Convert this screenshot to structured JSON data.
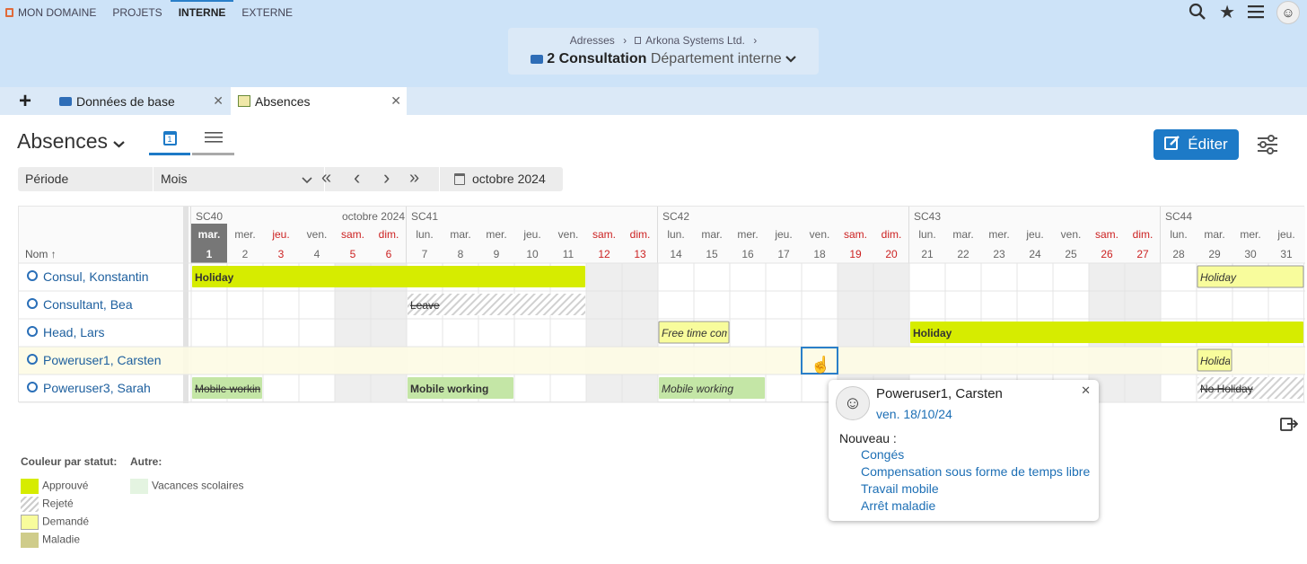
{
  "nav": {
    "items": [
      "MON DOMAINE",
      "PROJETS",
      "INTERNE",
      "EXTERNE"
    ],
    "active_index": 2
  },
  "breadcrumb": {
    "part1": "Adresses",
    "sep": "›",
    "part2": "Arkona Systems Ltd.",
    "sep2": "›"
  },
  "context": {
    "title": "2 Consultation",
    "subtitle": "Département interne"
  },
  "tabs": [
    {
      "label": "Données de base"
    },
    {
      "label": "Absences"
    }
  ],
  "page": {
    "title": "Absences",
    "edit_label": "Éditer"
  },
  "toolbar": {
    "period_label": "Période",
    "period_value": "Mois",
    "first": "«",
    "prev": "‹",
    "next": "›",
    "last": "»",
    "month": "octobre 2024"
  },
  "calendar": {
    "name_header": "Nom",
    "month_label": "octobre 2024",
    "weeks": [
      {
        "label": "SC40",
        "start": 1
      },
      {
        "label": "SC41",
        "start": 7
      },
      {
        "label": "SC42",
        "start": 14
      },
      {
        "label": "SC43",
        "start": 21
      },
      {
        "label": "SC44",
        "start": 28
      }
    ],
    "days": [
      {
        "dow": "mar.",
        "num": "1"
      },
      {
        "dow": "mer.",
        "num": "2"
      },
      {
        "dow": "jeu.",
        "num": "3"
      },
      {
        "dow": "ven.",
        "num": "4"
      },
      {
        "dow": "sam.",
        "num": "5"
      },
      {
        "dow": "dim.",
        "num": "6"
      },
      {
        "dow": "lun.",
        "num": "7"
      },
      {
        "dow": "mar.",
        "num": "8"
      },
      {
        "dow": "mer.",
        "num": "9"
      },
      {
        "dow": "jeu.",
        "num": "10"
      },
      {
        "dow": "ven.",
        "num": "11"
      },
      {
        "dow": "sam.",
        "num": "12"
      },
      {
        "dow": "dim.",
        "num": "13"
      },
      {
        "dow": "lun.",
        "num": "14"
      },
      {
        "dow": "mar.",
        "num": "15"
      },
      {
        "dow": "mer.",
        "num": "16"
      },
      {
        "dow": "jeu.",
        "num": "17"
      },
      {
        "dow": "ven.",
        "num": "18"
      },
      {
        "dow": "sam.",
        "num": "19"
      },
      {
        "dow": "dim.",
        "num": "20"
      },
      {
        "dow": "lun.",
        "num": "21"
      },
      {
        "dow": "mar.",
        "num": "22"
      },
      {
        "dow": "mer.",
        "num": "23"
      },
      {
        "dow": "jeu.",
        "num": "24"
      },
      {
        "dow": "ven.",
        "num": "25"
      },
      {
        "dow": "sam.",
        "num": "26"
      },
      {
        "dow": "dim.",
        "num": "27"
      },
      {
        "dow": "lun.",
        "num": "28"
      },
      {
        "dow": "mar.",
        "num": "29"
      },
      {
        "dow": "mer.",
        "num": "30"
      },
      {
        "dow": "jeu.",
        "num": "31"
      }
    ],
    "red_days": [
      3,
      5,
      6,
      12,
      13,
      19,
      20,
      26,
      27
    ],
    "weekend_days": [
      5,
      6,
      12,
      13,
      19,
      20,
      26,
      27
    ],
    "today": 1,
    "people": [
      {
        "name": "Consul, Konstantin",
        "absences": [
          {
            "label": "Holiday",
            "start": 1,
            "end": 11,
            "status": "approved"
          },
          {
            "label": "Holiday",
            "start": 29,
            "end": 31,
            "status": "requested"
          }
        ]
      },
      {
        "name": "Consultant, Bea",
        "absences": [
          {
            "label": "Leave",
            "start": 7,
            "end": 11,
            "status": "rejected"
          }
        ]
      },
      {
        "name": "Head, Lars",
        "absences": [
          {
            "label": "Free time compensation",
            "start": 14,
            "end": 15,
            "status": "requested"
          },
          {
            "label": "Holiday",
            "start": 21,
            "end": 31,
            "status": "approved"
          }
        ]
      },
      {
        "name": "Poweruser1, Carsten",
        "absences": [
          {
            "label": "Holiday",
            "start": 29,
            "end": 29,
            "status": "requested"
          }
        ]
      },
      {
        "name": "Poweruser3, Sarah",
        "absences": [
          {
            "label": "Mobile working",
            "start": 1,
            "end": 2,
            "status": "rejected_mobile"
          },
          {
            "label": "Mobile working",
            "start": 7,
            "end": 9,
            "status": "mobile"
          },
          {
            "label": "Mobile working",
            "start": 14,
            "end": 16,
            "status": "mobile_requested"
          },
          {
            "label": "No Holiday",
            "start": 29,
            "end": 31,
            "status": "rejected"
          }
        ]
      }
    ],
    "highlight_row": 3,
    "selected_day": 18
  },
  "legend": {
    "status_title": "Couleur par statut:",
    "other_title": "Autre:",
    "approved": "Approuvé",
    "rejected": "Rejeté",
    "requested": "Demandé",
    "sick": "Maladie",
    "holidays": "Vacances scolaires"
  },
  "popup": {
    "name": "Poweruser1, Carsten",
    "date": "ven. 18/10/24",
    "new_label": "Nouveau :",
    "options": [
      "Congés",
      "Compensation sous forme de temps libre",
      "Travail mobile",
      "Arrêt maladie"
    ]
  },
  "colors": {
    "approved": "#d6ec00",
    "requested": "#f8fc9c",
    "mobile": "#c4e6a6",
    "sick": "#cfcc8a",
    "holidays": "#e4f4e1",
    "accent": "#1d7ac7",
    "link": "#1d6fb5"
  }
}
